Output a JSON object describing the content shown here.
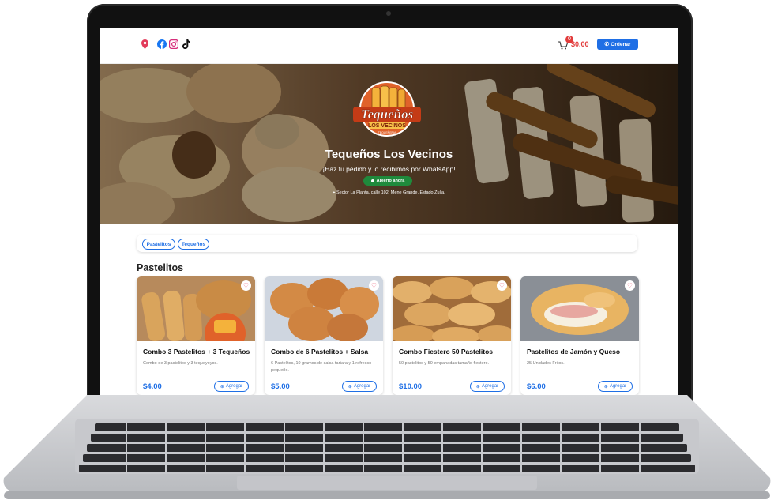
{
  "topbar": {
    "icons": [
      "location-pin-icon",
      "facebook-icon",
      "instagram-icon",
      "tiktok-icon"
    ],
    "cart_count": "0",
    "cart_total": "$0.00",
    "order_label": "Ordenar"
  },
  "hero": {
    "logo_text_main": "Tequeños",
    "logo_text_sub": "LOS VECINOS",
    "logo_text_small": "TEQUEÑERIA",
    "title": "Tequeños Los Vecinos",
    "subtitle": "¡Haz tu pedido y lo recibimos por WhatsApp!",
    "status": "Abierto ahora",
    "address": "Sector La Planta, calle 102, Mene Grande, Estado Zulia."
  },
  "categories": [
    "Pastelitos",
    "Tequeños"
  ],
  "section": {
    "title": "Pastelitos"
  },
  "products": [
    {
      "name": "Combo 3 Pastelitos + 3 Tequeños",
      "desc": "Combo de 3 pastelitos y 3 tequeyoyos.",
      "price": "$4.00",
      "add_label": "Agregar"
    },
    {
      "name": "Combo de 6 Pastelitos + Salsa",
      "desc": "6 Pastelitos, 10 gramos de salsa tartara y 1 refresco pequeño.",
      "price": "$5.00",
      "add_label": "Agregar"
    },
    {
      "name": "Combo Fiestero 50 Pastelitos",
      "desc": "50 pastelitos y 50 empanadas tamaño fiestero.",
      "price": "$10.00",
      "add_label": "Agregar"
    },
    {
      "name": "Pastelitos de Jamón y Queso",
      "desc": "25 Unidades Fritos.",
      "price": "$6.00",
      "add_label": "Agregar"
    }
  ],
  "colors": {
    "accent": "#1f6fe5",
    "cart": "#e23b3b",
    "open": "#1f8a3c",
    "logo": "#e0622a"
  }
}
